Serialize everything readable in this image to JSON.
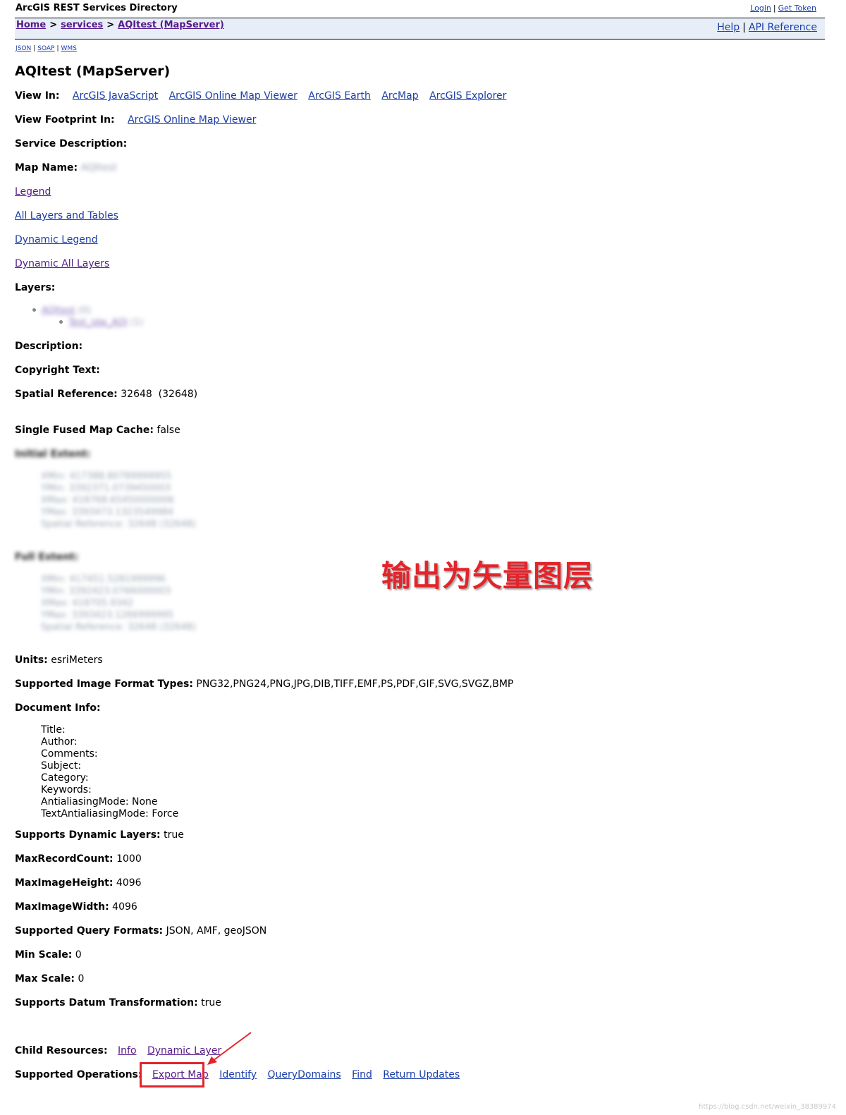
{
  "header": {
    "app_title": "ArcGIS REST Services Directory",
    "login": "Login",
    "get_token": "Get Token",
    "top_sep": "|",
    "breadcrumb": {
      "home": "Home",
      "services": "services",
      "current": "AQItest (MapServer)",
      "sep": ">"
    },
    "help": "Help",
    "api_reference": "API Reference",
    "help_sep": "|"
  },
  "formats": {
    "json": "JSON",
    "soap": "SOAP",
    "wms": "WMS",
    "sep": "|"
  },
  "page_title": "AQItest (MapServer)",
  "view_in": {
    "label": "View In:",
    "links": [
      "ArcGIS JavaScript",
      "ArcGIS Online Map Viewer",
      "ArcGIS Earth",
      "ArcMap",
      "ArcGIS Explorer"
    ]
  },
  "view_footprint": {
    "label": "View Footprint In:",
    "link": "ArcGIS Online Map Viewer"
  },
  "service_description": {
    "label": "Service Description:"
  },
  "map_name": {
    "label": "Map Name:",
    "value": "AQItest"
  },
  "resource_links": {
    "legend": "Legend",
    "all_layers": "All Layers and Tables",
    "dynamic_legend": "Dynamic Legend",
    "dynamic_all_layers": "Dynamic All Layers"
  },
  "layers": {
    "label": "Layers:",
    "items": [
      {
        "name": "AQItest",
        "id": "(0)"
      },
      {
        "name": "Test_idw_AQI",
        "id": "(1)"
      }
    ]
  },
  "description": {
    "label": "Description:"
  },
  "copyright": {
    "label": "Copyright Text:"
  },
  "spatial_reference": {
    "label": "Spatial Reference:",
    "value": "32648  (32648)"
  },
  "single_fused": {
    "label": "Single Fused Map Cache:",
    "value": "false"
  },
  "initial_extent": {
    "label": "Initial Extent:",
    "lines": [
      "XMin: 417388.80789999955",
      "YMin: 3392371.0739450003",
      "XMax: 418768.65450000006",
      "YMax: 3393473.1323549984",
      "Spatial Reference: 32648  (32648)"
    ]
  },
  "full_extent": {
    "label": "Full Extent:",
    "lines": [
      "XMin: 417451.5281999996",
      "YMin: 3392423.0766000003",
      "XMax: 418705.9342",
      "YMax: 3393423.1266999995",
      "Spatial Reference: 32648  (32648)"
    ]
  },
  "annotation": "输出为矢量图层",
  "units": {
    "label": "Units:",
    "value": "esriMeters"
  },
  "image_formats": {
    "label": "Supported Image Format Types:",
    "value": "PNG32,PNG24,PNG,JPG,DIB,TIFF,EMF,PS,PDF,GIF,SVG,SVGZ,BMP"
  },
  "document_info": {
    "label": "Document Info:",
    "lines": [
      "Title:",
      "Author:",
      "Comments:",
      "Subject:",
      "Category:",
      "Keywords:",
      "AntialiasingMode: None",
      "TextAntialiasingMode: Force"
    ]
  },
  "dynamic_layers": {
    "label": "Supports Dynamic Layers:",
    "value": "true"
  },
  "max_record": {
    "label": "MaxRecordCount:",
    "value": "1000"
  },
  "max_height": {
    "label": "MaxImageHeight:",
    "value": "4096"
  },
  "max_width": {
    "label": "MaxImageWidth:",
    "value": "4096"
  },
  "query_formats": {
    "label": "Supported Query Formats:",
    "value": "JSON, AMF, geoJSON"
  },
  "min_scale": {
    "label": "Min Scale:",
    "value": "0"
  },
  "max_scale": {
    "label": "Max Scale:",
    "value": "0"
  },
  "datum": {
    "label": "Supports Datum Transformation:",
    "value": "true"
  },
  "child_resources": {
    "label": "Child Resources:",
    "links": [
      "Info",
      "Dynamic Layer"
    ]
  },
  "operations": {
    "label": "Supported Operations:",
    "links": [
      "Export Map",
      "Identify",
      "QueryDomains",
      "Find",
      "Return Updates"
    ]
  },
  "colors": {
    "link": "#1a3ea8",
    "visited": "#551a8b",
    "navbar_bg": "#e8eef7",
    "annotation": "#e3242b"
  },
  "watermark": "https://blog.csdn.net/weixin_38389974"
}
